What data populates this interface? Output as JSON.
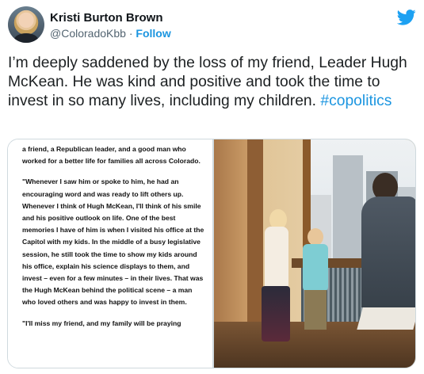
{
  "author": {
    "name": "Kristi Burton Brown",
    "handle": "@ColoradoKbb",
    "separator": "·",
    "follow_label": "Follow"
  },
  "tweet": {
    "text": "I’m deeply saddened by the loss of my friend, Leader Hugh McKean. He was kind and positive and took the time to invest in so many lives, including my children.",
    "hashtag": "#copolitics"
  },
  "media": {
    "document_paragraphs": [
      "a friend, a Republican leader, and a good man who worked for a better life for families all across Colorado.",
      "\"Whenever I saw him or spoke to him, he had an encouraging word and was ready to lift others up. Whenever I think of Hugh McKean, I'll think of his smile and his positive outlook on life. One of the best memories I have of him is when I visited his office at the Capitol with my kids. In the middle of a busy legislative session, he still took the time to show my kids around his office, explain his science displays to them, and invest – even for a few minutes – in their lives. That was the Hugh McKean behind the political scene – a man who loved others and was happy to invest in them.",
      "\"I'll miss my friend, and my family will be praying"
    ]
  },
  "icons": {
    "brand": "twitter-bird-icon",
    "brand_color": "#1da1f2",
    "link_color": "#1b95e0"
  }
}
